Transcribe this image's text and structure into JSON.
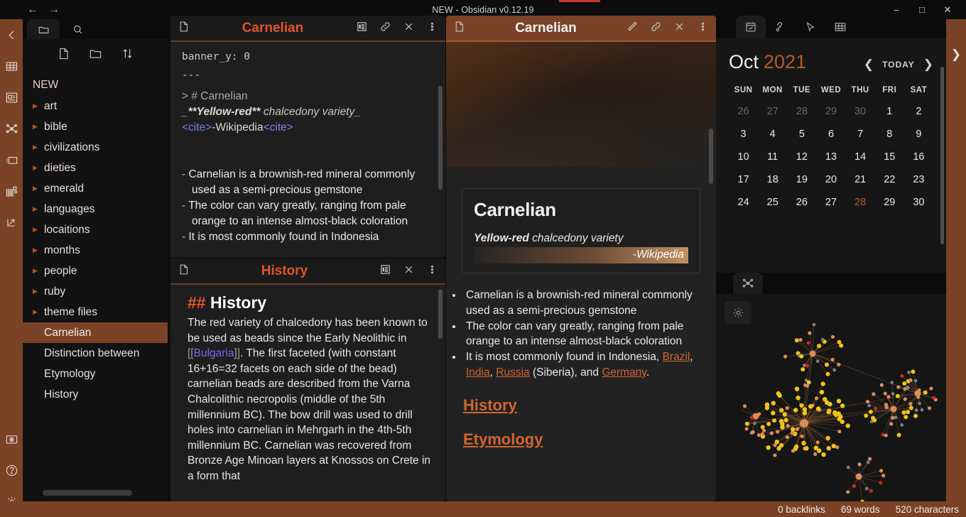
{
  "titlebar": {
    "back_icon": "back-arrow-icon",
    "forward_icon": "forward-arrow-icon",
    "title": "NEW - Obsidian v0.12.19",
    "minimize": "–",
    "maximize": "□",
    "close": "✕"
  },
  "ribbon": {
    "items": [
      {
        "name": "collapse-left-sidebar",
        "icon": "chevron-left-icon"
      },
      {
        "name": "open-table-view",
        "icon": "table-grid-icon"
      },
      {
        "name": "open-card-view",
        "icon": "card-panel-icon"
      },
      {
        "name": "open-graph-view",
        "icon": "graph-nodes-icon"
      },
      {
        "name": "open-cards-stack",
        "icon": "cards-stack-icon"
      },
      {
        "name": "open-blocks-view",
        "icon": "blocks-grid-icon"
      },
      {
        "name": "open-expand-view",
        "icon": "expand-arrow-icon"
      }
    ],
    "bottom_items": [
      {
        "name": "screenshot",
        "icon": "camera-icon"
      },
      {
        "name": "help",
        "icon": "question-circle-icon"
      },
      {
        "name": "settings",
        "icon": "gear-icon"
      }
    ]
  },
  "sidebar": {
    "tabs": [
      {
        "name": "files-tab",
        "icon": "folder-icon",
        "active": true
      },
      {
        "name": "search-tab",
        "icon": "search-icon",
        "active": false
      }
    ],
    "actions": [
      {
        "name": "new-note",
        "icon": "new-file-icon"
      },
      {
        "name": "new-folder",
        "icon": "new-folder-icon"
      },
      {
        "name": "change-sort-order",
        "icon": "sort-arrows-icon"
      }
    ],
    "vault_name": "NEW",
    "folders": [
      {
        "label": "art"
      },
      {
        "label": "bible"
      },
      {
        "label": "civilizations"
      },
      {
        "label": "dieties"
      },
      {
        "label": "emerald"
      },
      {
        "label": "languages"
      },
      {
        "label": "locaitions"
      },
      {
        "label": "months"
      },
      {
        "label": "people"
      },
      {
        "label": "ruby"
      },
      {
        "label": "theme files"
      }
    ],
    "files": [
      {
        "label": "Carnelian",
        "selected": true
      },
      {
        "label": "Distinction between ",
        "selected": false
      },
      {
        "label": "Etymology",
        "selected": false
      },
      {
        "label": "History",
        "selected": false
      }
    ]
  },
  "editor_pane": {
    "file_icon": "file-icon",
    "title": "Carnelian",
    "actions": [
      {
        "name": "toggle-reading-view",
        "icon": "reading-view-icon"
      },
      {
        "name": "link-note",
        "icon": "link-icon"
      },
      {
        "name": "close-pane",
        "icon": "close-icon"
      },
      {
        "name": "more-options",
        "icon": "vertical-dots-icon"
      }
    ],
    "source": {
      "frontmatter_line": "banner_y: 0",
      "frontmatter_end": "---",
      "quote_heading": "> # Carnelian",
      "quote_italic_prefix": "_",
      "quote_bold": "**Yellow-red**",
      "quote_italic_rest": " chalcedony variety_",
      "cite_open": "<cite>",
      "cite_text": "-Wikipedia",
      "cite_close": "<cite>",
      "bullets": [
        "Carnelian is a brownish-red mineral commonly used as a semi-precious gemstone",
        "The color can vary greatly, ranging from pale orange to an intense almost-black coloration",
        "It is most commonly found in Indonesia"
      ],
      "dash": "-"
    }
  },
  "history_pane": {
    "file_icon": "file-icon",
    "title": "History",
    "actions": [
      {
        "name": "toggle-reading-view",
        "icon": "reading-view-icon"
      },
      {
        "name": "close-pane",
        "icon": "close-icon"
      },
      {
        "name": "more-options",
        "icon": "vertical-dots-icon"
      }
    ],
    "heading_hash": "##",
    "heading_text": "History",
    "body_pre": "The red variety of chalcedony has been known to be used as beads since the Early Neolithic in ",
    "wikilink_open": "[[",
    "wikilink_text": "Bulgaria",
    "wikilink_close": "]]",
    "body_post": ". The first faceted (with constant 16+16=32 facets on each side of the bead) carnelian beads are described from the Varna Chalcolithic necropolis (middle of the 5th millennium BC). The bow drill was used to drill holes into carnelian in Mehrgarh in the 4th-5th millennium BC. Carnelian was recovered from Bronze Age Minoan layers at Knossos on Crete in a form that"
  },
  "preview_pane": {
    "file_icon": "file-icon",
    "title": "Carnelian",
    "actions": [
      {
        "name": "toggle-edit-view",
        "icon": "pencil-icon"
      },
      {
        "name": "link-note",
        "icon": "link-icon"
      },
      {
        "name": "close-pane",
        "icon": "close-icon"
      },
      {
        "name": "more-options",
        "icon": "vertical-dots-icon"
      }
    ],
    "banner_name": "note-banner-image",
    "callout": {
      "title": "Carnelian",
      "quote_bold": "Yellow-red",
      "quote_rest": " chalcedony variety",
      "cite": "-Wikipedia"
    },
    "bullets": [
      {
        "parts": [
          {
            "t": "Carnelian is a brownish-red mineral commonly used as a semi-precious gemstone",
            "link": false
          }
        ]
      },
      {
        "parts": [
          {
            "t": "The color can vary greatly, ranging from pale orange to an intense almost-black coloration",
            "link": false
          }
        ]
      },
      {
        "parts": [
          {
            "t": "It is most commonly found in Indonesia, ",
            "link": false
          },
          {
            "t": "Brazil",
            "link": true
          },
          {
            "t": ", ",
            "link": false
          },
          {
            "t": "India",
            "link": true
          },
          {
            "t": ", ",
            "link": false
          },
          {
            "t": "Russia",
            "link": true
          },
          {
            "t": " (Siberia), and ",
            "link": false
          },
          {
            "t": "Germany",
            "link": true
          },
          {
            "t": ".",
            "link": false
          }
        ]
      }
    ],
    "headings": [
      "History",
      "Etymology"
    ]
  },
  "right_sidebar": {
    "tabs": [
      {
        "name": "calendar-tab",
        "icon": "calendar-check-icon",
        "active": true
      },
      {
        "name": "tags-tab",
        "icon": "tag-link-icon",
        "active": false
      },
      {
        "name": "cursor-tab",
        "icon": "cursor-pointer-icon",
        "active": false
      },
      {
        "name": "table-tab",
        "icon": "table-grid-icon",
        "active": false
      }
    ],
    "calendar": {
      "month": "Oct",
      "year": "2021",
      "prev_icon": "chevron-left-icon",
      "today_label": "TODAY",
      "next_icon": "chevron-right-icon",
      "dow": [
        "SUN",
        "MON",
        "TUE",
        "WED",
        "THU",
        "FRI",
        "SAT"
      ],
      "weeks": [
        [
          {
            "d": "26",
            "s": "out"
          },
          {
            "d": "27",
            "s": "out"
          },
          {
            "d": "28",
            "s": "out"
          },
          {
            "d": "29",
            "s": "out"
          },
          {
            "d": "30",
            "s": "out"
          },
          {
            "d": "1",
            "s": ""
          },
          {
            "d": "2",
            "s": ""
          }
        ],
        [
          {
            "d": "3",
            "s": ""
          },
          {
            "d": "4",
            "s": ""
          },
          {
            "d": "5",
            "s": ""
          },
          {
            "d": "6",
            "s": ""
          },
          {
            "d": "7",
            "s": ""
          },
          {
            "d": "8",
            "s": ""
          },
          {
            "d": "9",
            "s": ""
          }
        ],
        [
          {
            "d": "10",
            "s": ""
          },
          {
            "d": "11",
            "s": ""
          },
          {
            "d": "12",
            "s": ""
          },
          {
            "d": "13",
            "s": ""
          },
          {
            "d": "14",
            "s": ""
          },
          {
            "d": "15",
            "s": ""
          },
          {
            "d": "16",
            "s": ""
          }
        ],
        [
          {
            "d": "17",
            "s": ""
          },
          {
            "d": "18",
            "s": ""
          },
          {
            "d": "19",
            "s": ""
          },
          {
            "d": "20",
            "s": ""
          },
          {
            "d": "21",
            "s": ""
          },
          {
            "d": "22",
            "s": ""
          },
          {
            "d": "23",
            "s": ""
          }
        ],
        [
          {
            "d": "24",
            "s": ""
          },
          {
            "d": "25",
            "s": ""
          },
          {
            "d": "26",
            "s": ""
          },
          {
            "d": "27",
            "s": ""
          },
          {
            "d": "28",
            "s": "today"
          },
          {
            "d": "29",
            "s": ""
          },
          {
            "d": "30",
            "s": ""
          }
        ]
      ]
    },
    "graph_panel": {
      "tab_icon": "graph-nodes-icon",
      "settings_icon": "gear-icon",
      "node_colors": {
        "primary": "#f0c419",
        "secondary": "#d98e5a",
        "accent": "#cc2a1e",
        "muted": "#7e7e7e",
        "edge": "#8a5a33"
      }
    }
  },
  "edges": {
    "expand_right_icon": "chevron-right-icon"
  },
  "statusbar": {
    "backlinks": "0 backlinks",
    "words": "69 words",
    "characters": "520 characters"
  },
  "colors": {
    "accent": "#7a4327",
    "accent_text": "#e2542a",
    "link": "#d2652f",
    "bg_dark": "#121212",
    "bg_pane": "#1e1e1e"
  }
}
